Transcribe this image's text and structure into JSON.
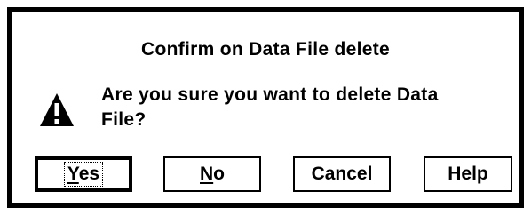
{
  "dialog": {
    "title": "Confirm on Data File delete",
    "message_line_1": "Are you sure you want to delete Data",
    "message_line_2": "File?",
    "icon": "warning-icon",
    "buttons": {
      "yes": {
        "label_first": "Y",
        "label_rest": "es",
        "default": true
      },
      "no": {
        "label_first": "N",
        "label_rest": "o"
      },
      "cancel": {
        "label": "Cancel"
      },
      "help": {
        "label": "Help"
      }
    }
  }
}
